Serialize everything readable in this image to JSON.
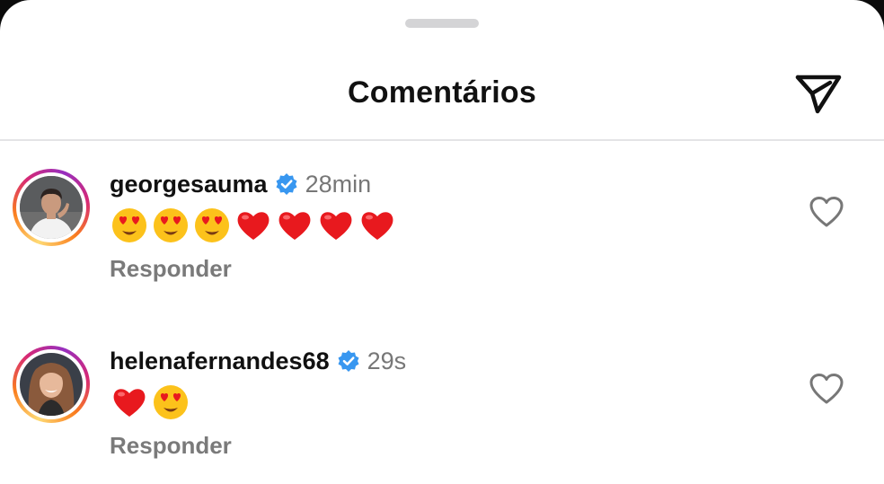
{
  "header": {
    "title": "Comentários",
    "share_icon": "paper-plane-icon"
  },
  "comments": [
    {
      "username": "georgesauma",
      "verified": true,
      "time": "28min",
      "emojis": [
        "heart-eyes",
        "heart-eyes",
        "heart-eyes",
        "red-heart",
        "red-heart",
        "red-heart",
        "red-heart"
      ],
      "reply_label": "Responder",
      "like_icon": "heart-outline-icon"
    },
    {
      "username": "helenafernandes68",
      "verified": true,
      "time": "29s",
      "emojis": [
        "red-heart",
        "heart-eyes"
      ],
      "reply_label": "Responder",
      "like_icon": "heart-outline-icon"
    }
  ],
  "colors": {
    "verified_badge": "#3897f0",
    "heart_red": "#e8191e",
    "emoji_yellow": "#fcc21b"
  }
}
